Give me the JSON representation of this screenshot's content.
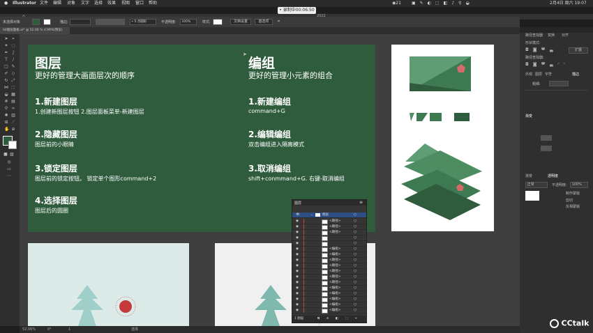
{
  "menubar": {
    "apple_icon": "apple-icon",
    "app_name": "Illustrator",
    "items": [
      "文件",
      "编辑",
      "对象",
      "文字",
      "选择",
      "效果",
      "视图",
      "窗口",
      "帮助"
    ],
    "status_number": "21",
    "clock": "2月4日 周六 19:07"
  },
  "recording": {
    "label": "• 录制中00:06:50",
    "year": "2022"
  },
  "control_bar": {
    "selection": "未选择对象",
    "stroke_label": "描边:",
    "brush_label": "5 点圆形",
    "opacity_label": "不透明度:",
    "opacity_value": "100%",
    "style_label": "样式:",
    "doc_setup": "文档设置",
    "prefs": "首选项"
  },
  "doc_tab": {
    "title": "04图层面板.ai* @ 52.06 % (CMYK/预览)"
  },
  "status_bar": {
    "zoom": "52.06%",
    "angle": "0°",
    "page": "1",
    "tool": "选择"
  },
  "green_board": {
    "left": {
      "title": "图层",
      "subtitle": "更好的管理大画面层次的顺序",
      "sections": [
        {
          "heading": "1.新建图层",
          "body": "1.创建新图层按钮  2.图层面板菜单-新建图层"
        },
        {
          "heading": "2.隐藏图层",
          "body": "图层前的小眼睛"
        },
        {
          "heading": "3.锁定图层",
          "body": "图层前的锁定按钮。     锁定单个图形command+2"
        },
        {
          "heading": "4.选择图层",
          "body": "图层后的圆圈"
        }
      ]
    },
    "right": {
      "title": "编组",
      "subtitle": "更好的管理小元素的组合",
      "sections": [
        {
          "heading": "1.新建编组",
          "body": "command+G"
        },
        {
          "heading": "2.编辑编组",
          "body": "双击编组进入隔离模式"
        },
        {
          "heading": "3.取消编组",
          "body": "shift+conmmand+G.          右键-取消编组"
        }
      ]
    }
  },
  "layers_panel": {
    "title": "图层",
    "top_layer": "图层",
    "rows": [
      "<路径>",
      "<路径>",
      "<路径>",
      "",
      "",
      "<编组>",
      "<编组>",
      "<路径>",
      "<路径>",
      "<路径>",
      "<路径>",
      "<路径>",
      "<编组>",
      "<编组>",
      "<编组>",
      "<编组>",
      "<编组>"
    ],
    "footer": "1 图层"
  },
  "right_panel": {
    "tabs": [
      "路径查找器",
      "变换",
      "对齐"
    ],
    "shape_mode": "形状模式:",
    "expand": "扩展",
    "pathfinder": "路径查找器:",
    "tabs2": [
      "外观",
      "图层",
      "字符",
      "描边"
    ],
    "stroke_weight": "粗细:",
    "gradient_label": "渐变",
    "transparency_tabs": [
      "渐变",
      "透明度"
    ],
    "blend_mode": "正常",
    "opacity_label": "不透明度:",
    "opacity_value": "100%",
    "mask": "制作蒙版",
    "clip": "剪切",
    "invert": "反相蒙版"
  },
  "watermark": {
    "text": "CCtalk"
  },
  "colors": {
    "board_green": "#2f5c3c",
    "canvas_bg": "#3f3f3f",
    "ui_dark": "#2e2e2e"
  }
}
